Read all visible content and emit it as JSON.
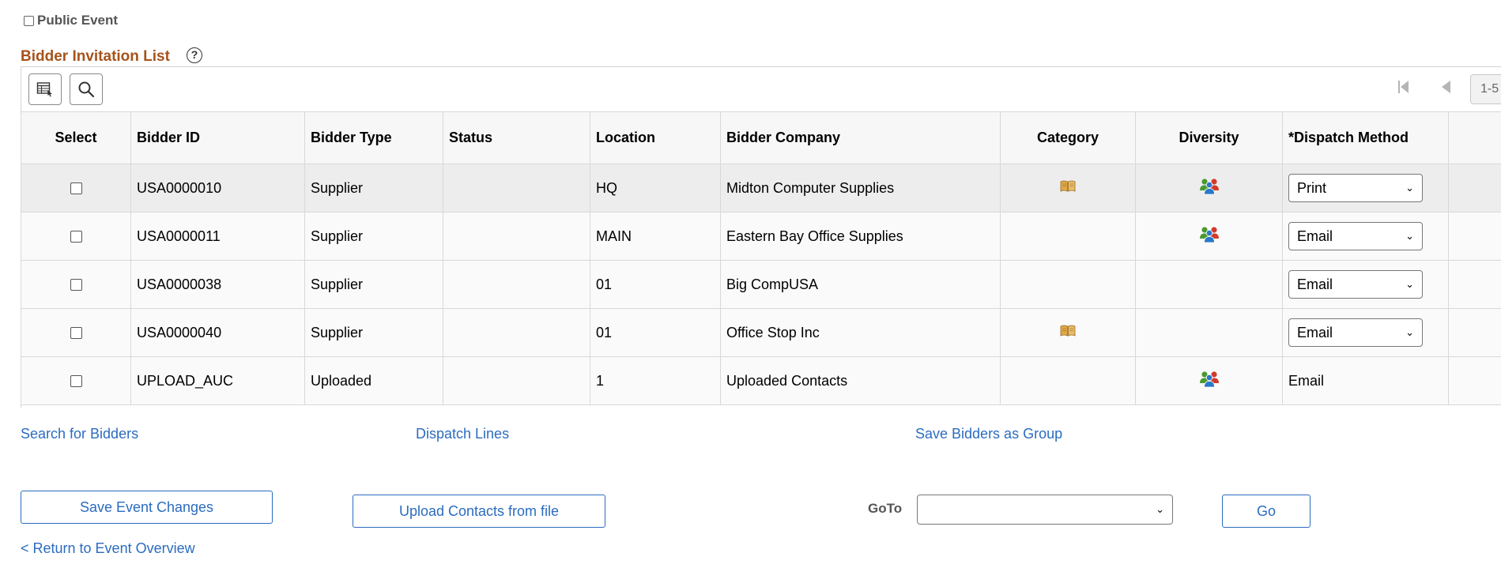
{
  "header": {
    "public_event_label": "Public Event",
    "grid_title": "Bidder Invitation List",
    "help_label": "?"
  },
  "toolbar": {
    "page_range": "1-5"
  },
  "table": {
    "columns": [
      "Select",
      "Bidder ID",
      "Bidder Type",
      "Status",
      "Location",
      "Bidder Company",
      "Category",
      "Diversity",
      "*Dispatch Method"
    ],
    "rows": [
      {
        "bidder_id": "USA0000010",
        "bidder_type": "Supplier",
        "status": "",
        "location": "HQ",
        "company": "Midton Computer Supplies",
        "category": true,
        "diversity": true,
        "dispatch": "Print",
        "dispatch_editable": true
      },
      {
        "bidder_id": "USA0000011",
        "bidder_type": "Supplier",
        "status": "",
        "location": "MAIN",
        "company": "Eastern Bay Office Supplies",
        "category": false,
        "diversity": true,
        "dispatch": "Email",
        "dispatch_editable": true
      },
      {
        "bidder_id": "USA0000038",
        "bidder_type": "Supplier",
        "status": "",
        "location": "01",
        "company": "Big CompUSA",
        "category": false,
        "diversity": false,
        "dispatch": "Email",
        "dispatch_editable": true
      },
      {
        "bidder_id": "USA0000040",
        "bidder_type": "Supplier",
        "status": "",
        "location": "01",
        "company": "Office Stop Inc",
        "category": true,
        "diversity": false,
        "dispatch": "Email",
        "dispatch_editable": true
      },
      {
        "bidder_id": "UPLOAD_AUC",
        "bidder_type": "Uploaded",
        "status": "",
        "location": "1",
        "company": "Uploaded Contacts",
        "category": false,
        "diversity": true,
        "dispatch": "Email",
        "dispatch_editable": false
      }
    ]
  },
  "links": {
    "search_bidders": "Search for Bidders",
    "dispatch_lines": "Dispatch Lines",
    "save_bidders_group": "Save Bidders as Group",
    "return_overview": "< Return to Event Overview"
  },
  "buttons": {
    "save_event": "Save Event Changes",
    "upload_contacts": "Upload Contacts from file",
    "go": "Go"
  },
  "goto": {
    "label": "GoTo",
    "selected": ""
  },
  "icons": {
    "category": "category-book-icon",
    "diversity": "diversity-people-icon",
    "grid_view": "grid-view-icon",
    "search": "search-icon",
    "first_page": "first-page-icon",
    "prev_page": "prev-page-icon"
  },
  "colors": {
    "title": "#a6531b",
    "link": "#2b6cbf",
    "diversity_green": "#4a9a2e",
    "diversity_blue": "#2a78c8",
    "diversity_red": "#d23a2a",
    "category_book": "#e0a848"
  }
}
